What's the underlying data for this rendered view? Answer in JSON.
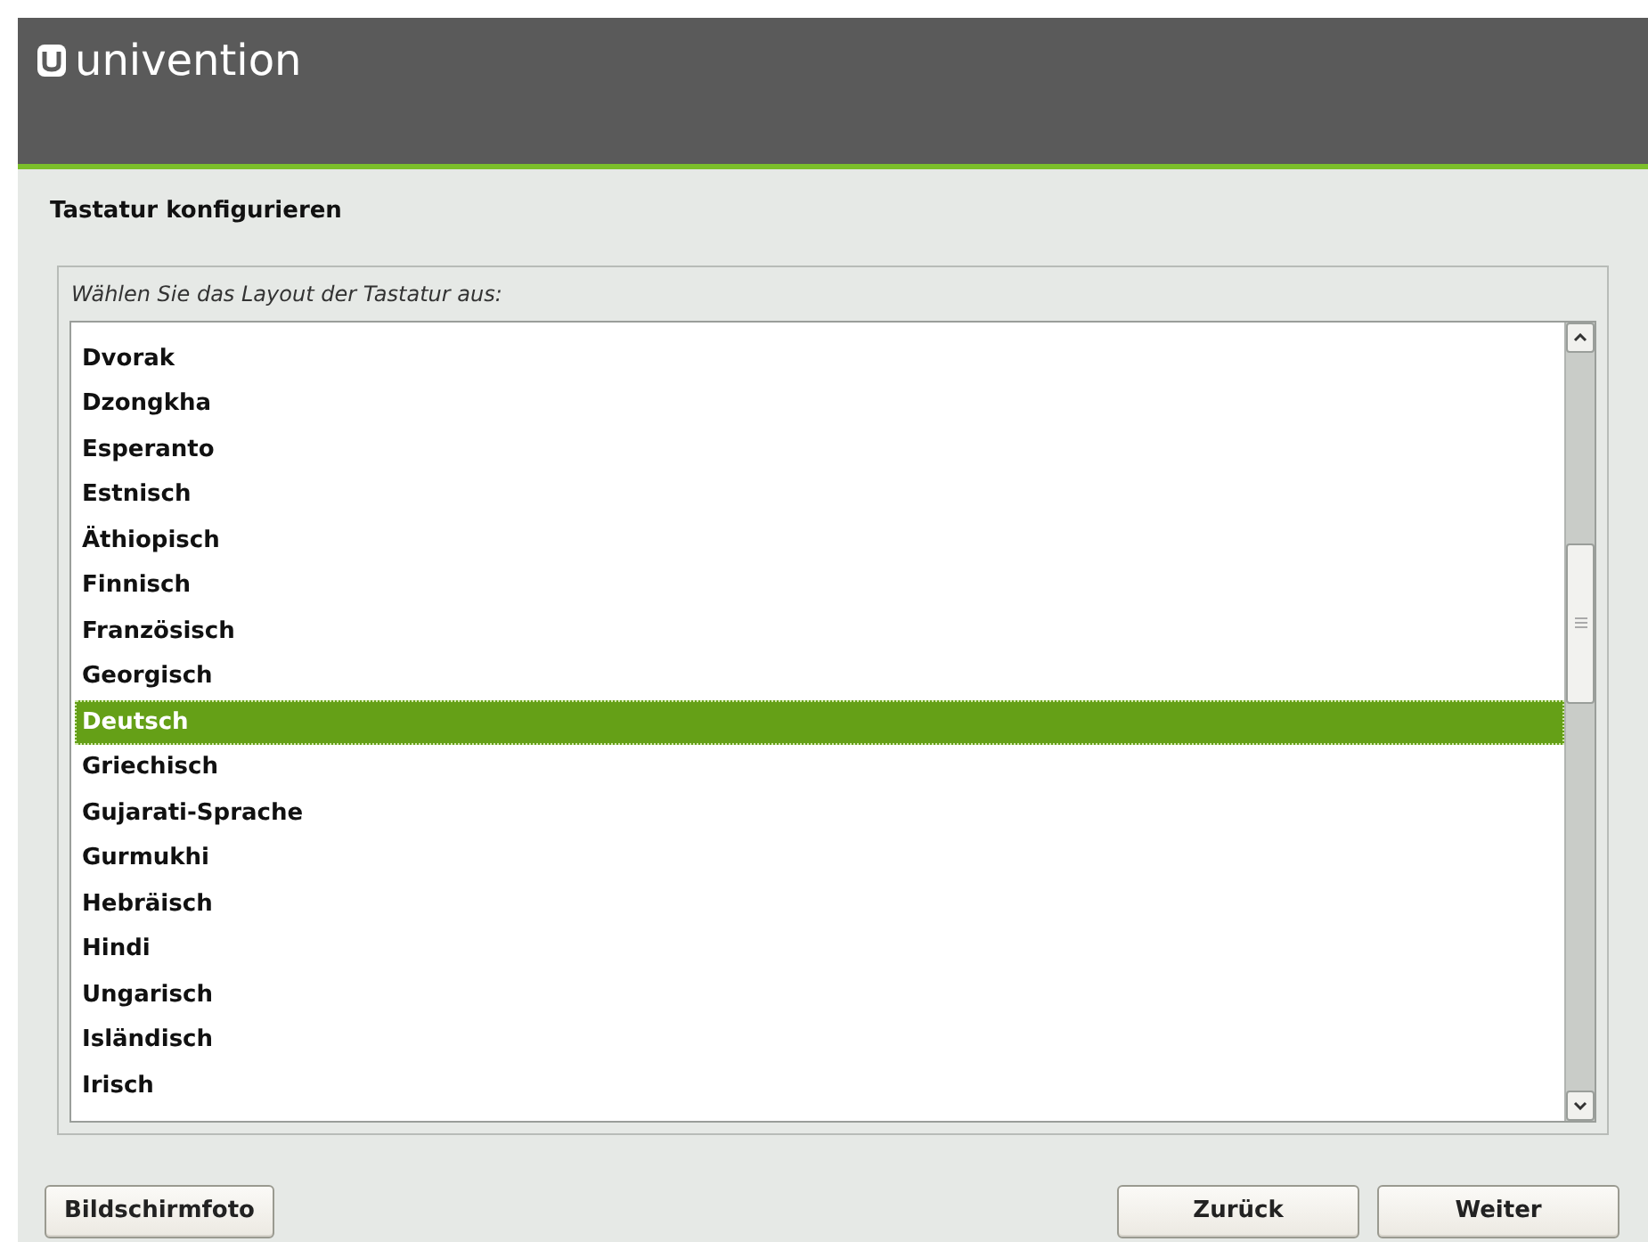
{
  "header": {
    "logo_text": "univention"
  },
  "title": "Tastatur konfigurieren",
  "prompt": "Wählen Sie das Layout der Tastatur aus:",
  "layouts": [
    {
      "label": "Dvorak",
      "selected": false
    },
    {
      "label": "Dzongkha",
      "selected": false
    },
    {
      "label": "Esperanto",
      "selected": false
    },
    {
      "label": "Estnisch",
      "selected": false
    },
    {
      "label": "Äthiopisch",
      "selected": false
    },
    {
      "label": "Finnisch",
      "selected": false
    },
    {
      "label": "Französisch",
      "selected": false
    },
    {
      "label": "Georgisch",
      "selected": false
    },
    {
      "label": "Deutsch",
      "selected": true
    },
    {
      "label": "Griechisch",
      "selected": false
    },
    {
      "label": "Gujarati-Sprache",
      "selected": false
    },
    {
      "label": "Gurmukhi",
      "selected": false
    },
    {
      "label": "Hebräisch",
      "selected": false
    },
    {
      "label": "Hindi",
      "selected": false
    },
    {
      "label": "Ungarisch",
      "selected": false
    },
    {
      "label": "Isländisch",
      "selected": false
    },
    {
      "label": "Irisch",
      "selected": false
    }
  ],
  "buttons": {
    "left": "Bildschirmfoto",
    "right": [
      "Zurück",
      "Weiter"
    ]
  }
}
